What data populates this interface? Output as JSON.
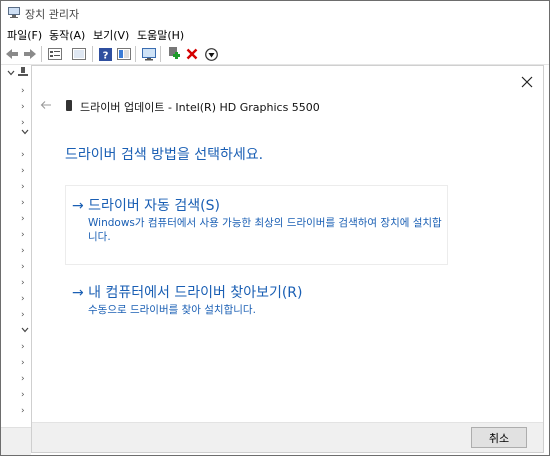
{
  "window": {
    "title": "장치 관리자"
  },
  "menu": [
    {
      "label": "파일(F)"
    },
    {
      "label": "동작(A)"
    },
    {
      "label": "보기(V)"
    },
    {
      "label": "도움말(H)"
    }
  ],
  "toolbar": {
    "icons": [
      "back-arrow-icon",
      "forward-arrow-icon",
      "properties-icon",
      "view-icon",
      "help-icon",
      "view-details-icon",
      "monitor-icon",
      "add-driver-icon",
      "uninstall-icon",
      "download-icon"
    ]
  },
  "tree": {
    "glyphs": [
      "›",
      "⌄",
      "›",
      "›",
      "›",
      "⌄",
      "›",
      "›",
      "›",
      "›",
      "›",
      "›",
      "›",
      "›",
      "›",
      "›",
      "›",
      "⌄",
      "›",
      "›",
      "›",
      "›",
      "›"
    ]
  },
  "dialog": {
    "header": "드라이버 업데이트 - Intel(R) HD Graphics 5500",
    "heading": "드라이버 검색 방법을 선택하세요.",
    "options": [
      {
        "title": "→  드라이버 자동 검색(S)",
        "description": "Windows가 컴퓨터에서 사용 가능한 최상의 드라이버를 검색하여 장치에 설치합니다."
      },
      {
        "title": "→  내 컴퓨터에서 드라이버 찾아보기(R)",
        "description": "수동으로 드라이버를 찾아 설치합니다."
      }
    ],
    "cancel_label": "취소"
  },
  "colors": {
    "accent_blue": "#1a5fb4",
    "delete_red": "#d40000",
    "add_green": "#1f9b2b"
  }
}
